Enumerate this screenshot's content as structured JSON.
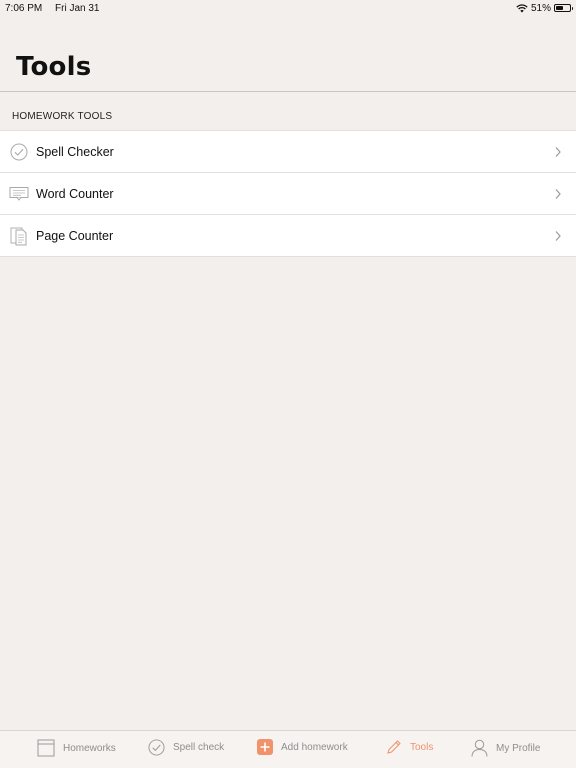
{
  "status": {
    "time": "7:06 PM",
    "date": "Fri Jan 31",
    "battery": "51%",
    "battery_level": 0.51
  },
  "page": {
    "title": "Tools"
  },
  "section": {
    "header": "HOMEWORK TOOLS"
  },
  "tools": [
    {
      "label": "Spell Checker",
      "icon": "check-circle-icon"
    },
    {
      "label": "Word Counter",
      "icon": "speech-bubble-icon"
    },
    {
      "label": "Page Counter",
      "icon": "document-pages-icon"
    }
  ],
  "tabs": [
    {
      "label": "Homeworks",
      "icon": "notebook-icon",
      "active": false
    },
    {
      "label": "Spell check",
      "icon": "check-circle-icon",
      "active": false
    },
    {
      "label": "Add homework",
      "icon": "plus-square-icon",
      "active": false
    },
    {
      "label": "Tools",
      "icon": "pencil-icon",
      "active": true
    },
    {
      "label": "My Profile",
      "icon": "person-icon",
      "active": false
    }
  ],
  "colors": {
    "accent": "#f0926a",
    "background": "#f3efec",
    "inactive": "#8e8e8e"
  }
}
